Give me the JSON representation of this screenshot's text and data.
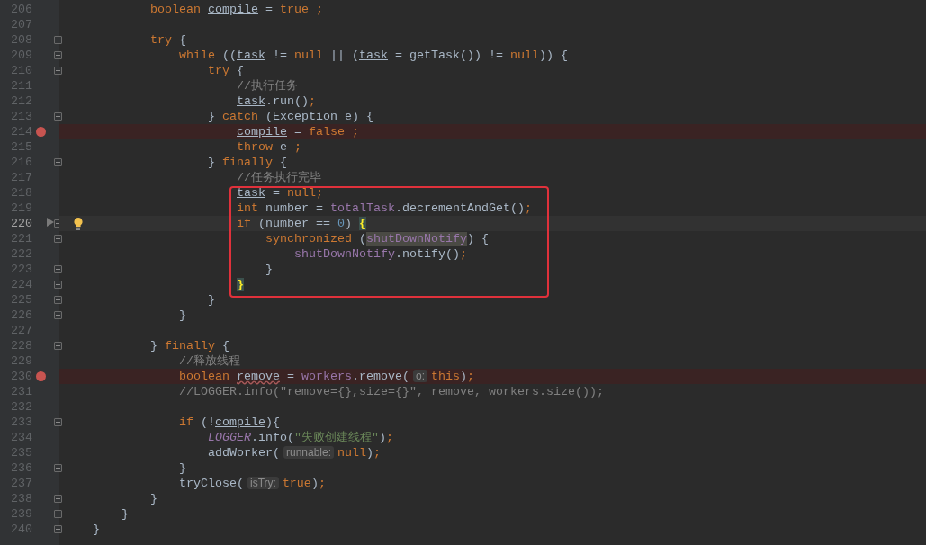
{
  "editor": {
    "lines": [
      {
        "number": "206",
        "breakpoint": false,
        "current": false,
        "fold": false,
        "intention": false,
        "tokens": [
          {
            "kind": "keyword",
            "text": "            boolean "
          },
          {
            "kind": "local",
            "text": "compile"
          },
          {
            "kind": "plain",
            "text": " = "
          },
          {
            "kind": "keyword",
            "text": "true ;"
          }
        ]
      },
      {
        "number": "207",
        "breakpoint": false,
        "current": false,
        "fold": false,
        "intention": false
      },
      {
        "number": "208",
        "breakpoint": false,
        "current": false,
        "fold": true,
        "intention": false,
        "tokens": [
          {
            "kind": "keyword",
            "text": "            try "
          },
          {
            "kind": "plain",
            "text": "{"
          }
        ]
      },
      {
        "number": "209",
        "breakpoint": false,
        "current": false,
        "fold": true,
        "intention": false,
        "tokens": [
          {
            "kind": "keyword",
            "text": "                while "
          },
          {
            "kind": "plain",
            "text": "(("
          },
          {
            "kind": "local",
            "text": "task"
          },
          {
            "kind": "plain",
            "text": " != "
          },
          {
            "kind": "keyword",
            "text": "null"
          },
          {
            "kind": "plain",
            "text": " || ("
          },
          {
            "kind": "local",
            "text": "task"
          },
          {
            "kind": "plain",
            "text": " = getTask()) != "
          },
          {
            "kind": "keyword",
            "text": "null"
          },
          {
            "kind": "plain",
            "text": ")) {"
          }
        ]
      },
      {
        "number": "210",
        "breakpoint": false,
        "current": false,
        "fold": true,
        "intention": false,
        "tokens": [
          {
            "kind": "keyword",
            "text": "                    try "
          },
          {
            "kind": "plain",
            "text": "{"
          }
        ]
      },
      {
        "number": "211",
        "breakpoint": false,
        "current": false,
        "fold": false,
        "intention": false,
        "tokens": [
          {
            "kind": "comment",
            "text": "                        //执行任务"
          }
        ]
      },
      {
        "number": "212",
        "breakpoint": false,
        "current": false,
        "fold": false,
        "intention": false,
        "tokens": [
          {
            "kind": "local",
            "text": "                        task"
          },
          {
            "kind": "plain",
            "text": ".run()"
          },
          {
            "kind": "keyword",
            "text": ";"
          }
        ]
      },
      {
        "number": "213",
        "breakpoint": false,
        "current": false,
        "fold": true,
        "intention": false,
        "tokens": [
          {
            "kind": "plain",
            "text": "                    } "
          },
          {
            "kind": "keyword",
            "text": "catch "
          },
          {
            "kind": "plain",
            "text": "(Exception e) {"
          }
        ]
      },
      {
        "number": "214",
        "breakpoint": true,
        "current": false,
        "fold": false,
        "intention": false,
        "tokens": [
          {
            "kind": "local",
            "text": "                        compile"
          },
          {
            "kind": "plain",
            "text": " = "
          },
          {
            "kind": "keyword",
            "text": "false ;"
          }
        ]
      },
      {
        "number": "215",
        "breakpoint": false,
        "current": false,
        "fold": false,
        "intention": false,
        "tokens": [
          {
            "kind": "keyword",
            "text": "                        throw "
          },
          {
            "kind": "plain",
            "text": "e "
          },
          {
            "kind": "keyword",
            "text": ";"
          }
        ]
      },
      {
        "number": "216",
        "breakpoint": false,
        "current": false,
        "fold": true,
        "intention": false,
        "tokens": [
          {
            "kind": "plain",
            "text": "                    } "
          },
          {
            "kind": "keyword",
            "text": "finally "
          },
          {
            "kind": "plain",
            "text": "{"
          }
        ]
      },
      {
        "number": "217",
        "breakpoint": false,
        "current": false,
        "fold": false,
        "intention": false,
        "tokens": [
          {
            "kind": "comment",
            "text": "                        //任务执行完毕"
          }
        ]
      },
      {
        "number": "218",
        "breakpoint": false,
        "current": false,
        "fold": false,
        "intention": false,
        "tokens": [
          {
            "kind": "local",
            "text": "                        task"
          },
          {
            "kind": "plain",
            "text": " = "
          },
          {
            "kind": "keyword",
            "text": "null;"
          }
        ]
      },
      {
        "number": "219",
        "breakpoint": false,
        "current": false,
        "fold": false,
        "intention": false,
        "tokens": [
          {
            "kind": "keyword",
            "text": "                        int "
          },
          {
            "kind": "plain",
            "text": "number = "
          },
          {
            "kind": "field",
            "text": "totalTask"
          },
          {
            "kind": "plain",
            "text": ".decrementAndGet()"
          },
          {
            "kind": "keyword",
            "text": ";"
          }
        ]
      },
      {
        "number": "220",
        "breakpoint": false,
        "current": true,
        "fold": true,
        "intention": true,
        "tokens": [
          {
            "kind": "keyword",
            "text": "                        if "
          },
          {
            "kind": "plain",
            "text": "(number == "
          },
          {
            "kind": "number",
            "text": "0"
          },
          {
            "kind": "plain",
            "text": ") "
          },
          {
            "kind": "brace",
            "text": "{"
          }
        ]
      },
      {
        "number": "221",
        "breakpoint": false,
        "current": false,
        "fold": true,
        "intention": false,
        "tokens": [
          {
            "kind": "keyword",
            "text": "                            synchronized "
          },
          {
            "kind": "plain",
            "text": "("
          },
          {
            "kind": "field-highlight",
            "text": "shutDownNotify"
          },
          {
            "kind": "plain",
            "text": ") {"
          }
        ]
      },
      {
        "number": "222",
        "breakpoint": false,
        "current": false,
        "fold": false,
        "intention": false,
        "tokens": [
          {
            "kind": "field",
            "text": "                                shutDownNotify"
          },
          {
            "kind": "plain",
            "text": ".notify()"
          },
          {
            "kind": "keyword",
            "text": ";"
          }
        ]
      },
      {
        "number": "223",
        "breakpoint": false,
        "current": false,
        "fold": true,
        "intention": false,
        "tokens": [
          {
            "kind": "plain",
            "text": "                            }"
          }
        ]
      },
      {
        "number": "224",
        "breakpoint": false,
        "current": false,
        "fold": true,
        "intention": false,
        "tokens": [
          {
            "kind": "brace",
            "text": "                        }"
          }
        ]
      },
      {
        "number": "225",
        "breakpoint": false,
        "current": false,
        "fold": true,
        "intention": false,
        "tokens": [
          {
            "kind": "plain",
            "text": "                    }"
          }
        ]
      },
      {
        "number": "226",
        "breakpoint": false,
        "current": false,
        "fold": true,
        "intention": false,
        "tokens": [
          {
            "kind": "plain",
            "text": "                }"
          }
        ]
      },
      {
        "number": "227",
        "breakpoint": false,
        "current": false,
        "fold": false,
        "intention": false
      },
      {
        "number": "228",
        "breakpoint": false,
        "current": false,
        "fold": true,
        "intention": false,
        "tokens": [
          {
            "kind": "plain",
            "text": "            } "
          },
          {
            "kind": "keyword",
            "text": "finally "
          },
          {
            "kind": "plain",
            "text": "{"
          }
        ]
      },
      {
        "number": "229",
        "breakpoint": false,
        "current": false,
        "fold": false,
        "intention": false,
        "tokens": [
          {
            "kind": "comment",
            "text": "                //释放线程"
          }
        ]
      },
      {
        "number": "230",
        "breakpoint": true,
        "current": false,
        "fold": false,
        "intention": false,
        "tokens": [
          {
            "kind": "keyword",
            "text": "                boolean "
          },
          {
            "kind": "unused",
            "text": "remove"
          },
          {
            "kind": "plain",
            "text": " = "
          },
          {
            "kind": "field",
            "text": "workers"
          },
          {
            "kind": "plain",
            "text": ".remove("
          },
          {
            "kind": "hint",
            "text": "o:"
          },
          {
            "kind": "keyword",
            "text": "this"
          },
          {
            "kind": "plain",
            "text": ")"
          },
          {
            "kind": "keyword",
            "text": ";"
          }
        ]
      },
      {
        "number": "231",
        "breakpoint": false,
        "current": false,
        "fold": false,
        "intention": false,
        "tokens": [
          {
            "kind": "comment",
            "text": "                //LOGGER.info(\"remove={},size={}\", remove, workers.size());"
          }
        ]
      },
      {
        "number": "232",
        "breakpoint": false,
        "current": false,
        "fold": false,
        "intention": false
      },
      {
        "number": "233",
        "breakpoint": false,
        "current": false,
        "fold": true,
        "intention": false,
        "tokens": [
          {
            "kind": "keyword",
            "text": "                if "
          },
          {
            "kind": "plain",
            "text": "(!"
          },
          {
            "kind": "local",
            "text": "compile"
          },
          {
            "kind": "plain",
            "text": "){"
          }
        ]
      },
      {
        "number": "234",
        "breakpoint": false,
        "current": false,
        "fold": false,
        "intention": false,
        "tokens": [
          {
            "kind": "static",
            "text": "                    LOGGER"
          },
          {
            "kind": "plain",
            "text": ".info("
          },
          {
            "kind": "string",
            "text": "\"失败创建线程\""
          },
          {
            "kind": "plain",
            "text": ")"
          },
          {
            "kind": "keyword",
            "text": ";"
          }
        ]
      },
      {
        "number": "235",
        "breakpoint": false,
        "current": false,
        "fold": false,
        "intention": false,
        "tokens": [
          {
            "kind": "plain",
            "text": "                    addWorker("
          },
          {
            "kind": "hint",
            "text": "runnable:"
          },
          {
            "kind": "keyword",
            "text": "null"
          },
          {
            "kind": "plain",
            "text": ")"
          },
          {
            "kind": "keyword",
            "text": ";"
          }
        ]
      },
      {
        "number": "236",
        "breakpoint": false,
        "current": false,
        "fold": true,
        "intention": false,
        "tokens": [
          {
            "kind": "plain",
            "text": "                }"
          }
        ]
      },
      {
        "number": "237",
        "breakpoint": false,
        "current": false,
        "fold": false,
        "intention": false,
        "tokens": [
          {
            "kind": "plain",
            "text": "                tryClose("
          },
          {
            "kind": "hint",
            "text": "isTry:"
          },
          {
            "kind": "keyword",
            "text": "true"
          },
          {
            "kind": "plain",
            "text": ")"
          },
          {
            "kind": "keyword",
            "text": ";"
          }
        ]
      },
      {
        "number": "238",
        "breakpoint": false,
        "current": false,
        "fold": true,
        "intention": false,
        "tokens": [
          {
            "kind": "plain",
            "text": "            }"
          }
        ]
      },
      {
        "number": "239",
        "breakpoint": false,
        "current": false,
        "fold": true,
        "intention": false,
        "tokens": [
          {
            "kind": "plain",
            "text": "        }"
          }
        ]
      },
      {
        "number": "240",
        "breakpoint": false,
        "current": false,
        "fold": true,
        "intention": false,
        "tokens": [
          {
            "kind": "plain",
            "text": "    }"
          }
        ]
      }
    ]
  }
}
